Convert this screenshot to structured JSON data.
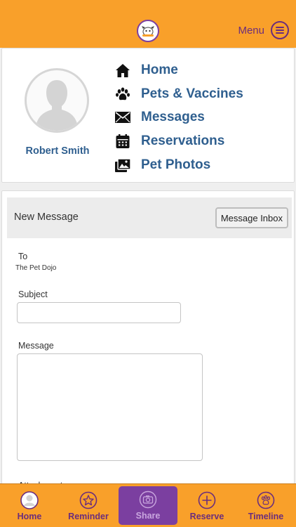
{
  "header": {
    "menu_label": "Menu"
  },
  "profile": {
    "name": "Robert Smith"
  },
  "nav": [
    {
      "label": "Home",
      "icon": "home-icon"
    },
    {
      "label": "Pets & Vaccines",
      "icon": "paw-icon"
    },
    {
      "label": "Messages",
      "icon": "envelope-icon"
    },
    {
      "label": "Reservations",
      "icon": "calendar-icon"
    },
    {
      "label": "Pet Photos",
      "icon": "photos-icon"
    }
  ],
  "message_form": {
    "title": "New Message",
    "inbox_button": "Message Inbox",
    "to_label": "To",
    "to_value": "The Pet Dojo",
    "subject_label": "Subject",
    "subject_value": "",
    "message_label": "Message",
    "message_value": "",
    "attachment_label": "Attachment"
  },
  "tabs": [
    {
      "label": "Home",
      "icon": "avatar-icon"
    },
    {
      "label": "Reminder",
      "icon": "star-icon"
    },
    {
      "label": "Share",
      "icon": "camera-icon",
      "active": true
    },
    {
      "label": "Reserve",
      "icon": "plus-icon"
    },
    {
      "label": "Timeline",
      "icon": "paw-icon"
    }
  ],
  "colors": {
    "header": "#f9a02a",
    "accent": "#6b2d7c",
    "active_tab": "#7b3fa0",
    "link": "#2f5f8f"
  }
}
